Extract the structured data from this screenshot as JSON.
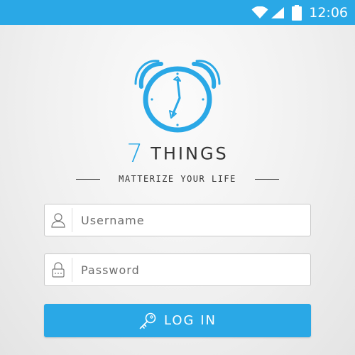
{
  "status_bar": {
    "time": "12:06",
    "icons": [
      "wifi-icon",
      "cell-signal-icon",
      "battery-icon"
    ],
    "background": "#2aa8e6"
  },
  "brand": {
    "number": "7",
    "word": "THINGS",
    "tagline": "MATTERIZE YOUR LIFE",
    "logo_icon": "alarm-clock-icon",
    "accent_color": "#2aa8e6"
  },
  "form": {
    "username": {
      "placeholder": "Username",
      "value": "",
      "icon": "user-icon"
    },
    "password": {
      "placeholder": "Password",
      "value": "",
      "icon": "lock-icon"
    },
    "login_label": "LOG IN",
    "login_icon": "key-icon"
  }
}
